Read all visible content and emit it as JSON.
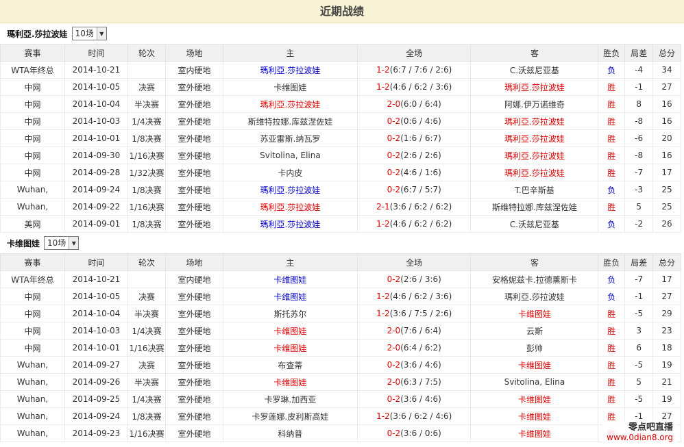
{
  "title": "近期战绩",
  "columns": [
    "赛事",
    "时间",
    "轮次",
    "场地",
    "主",
    "全场",
    "客",
    "胜负",
    "局差",
    "总分"
  ],
  "sections": [
    {
      "player": "瑪利亞.莎拉波娃",
      "count_option": "10场",
      "rows": [
        {
          "event": "WTA年终总",
          "date": "2014-10-21",
          "round": "",
          "surface": "室内硬地",
          "home": "瑪利亞.莎拉波娃",
          "home_style": "blue",
          "score_main": "1-2",
          "score_detail": "(6:7 / 7:6 / 2:6)",
          "away": "C.沃兹尼亚基",
          "away_style": "",
          "result": "负",
          "diff": "-4",
          "total": "34"
        },
        {
          "event": "中网",
          "date": "2014-10-05",
          "round": "决赛",
          "surface": "室外硬地",
          "home": "卡维图娃",
          "home_style": "",
          "score_main": "1-2",
          "score_detail": "(4:6 / 6:2 / 3:6)",
          "away": "瑪利亞.莎拉波娃",
          "away_style": "red",
          "result": "胜",
          "diff": "-1",
          "total": "27"
        },
        {
          "event": "中网",
          "date": "2014-10-04",
          "round": "半决赛",
          "surface": "室外硬地",
          "home": "瑪利亞.莎拉波娃",
          "home_style": "red",
          "score_main": "2-0",
          "score_detail": "(6:0 / 6:4)",
          "away": "阿娜.伊万诺维奇",
          "away_style": "",
          "result": "胜",
          "diff": "8",
          "total": "16"
        },
        {
          "event": "中网",
          "date": "2014-10-03",
          "round": "1/4决赛",
          "surface": "室外硬地",
          "home": "斯维特拉娜.库兹涅佐娃",
          "home_style": "",
          "score_main": "0-2",
          "score_detail": "(0:6 / 4:6)",
          "away": "瑪利亞.莎拉波娃",
          "away_style": "red",
          "result": "胜",
          "diff": "-8",
          "total": "16"
        },
        {
          "event": "中网",
          "date": "2014-10-01",
          "round": "1/8决赛",
          "surface": "室外硬地",
          "home": "苏亚雷斯.纳瓦罗",
          "home_style": "",
          "score_main": "0-2",
          "score_detail": "(1:6 / 6:7)",
          "away": "瑪利亞.莎拉波娃",
          "away_style": "red",
          "result": "胜",
          "diff": "-6",
          "total": "20"
        },
        {
          "event": "中网",
          "date": "2014-09-30",
          "round": "1/16决赛",
          "surface": "室外硬地",
          "home": "Svitolina, Elina",
          "home_style": "",
          "score_main": "0-2",
          "score_detail": "(2:6 / 2:6)",
          "away": "瑪利亞.莎拉波娃",
          "away_style": "red",
          "result": "胜",
          "diff": "-8",
          "total": "16"
        },
        {
          "event": "中网",
          "date": "2014-09-28",
          "round": "1/32决赛",
          "surface": "室外硬地",
          "home": "卡内皮",
          "home_style": "",
          "score_main": "0-2",
          "score_detail": "(4:6 / 1:6)",
          "away": "瑪利亞.莎拉波娃",
          "away_style": "red",
          "result": "胜",
          "diff": "-7",
          "total": "17"
        },
        {
          "event": "Wuhan,",
          "date": "2014-09-24",
          "round": "1/8决赛",
          "surface": "室外硬地",
          "home": "瑪利亞.莎拉波娃",
          "home_style": "blue",
          "score_main": "0-2",
          "score_detail": "(6:7 / 5:7)",
          "away": "T.巴辛斯基",
          "away_style": "",
          "result": "负",
          "diff": "-3",
          "total": "25"
        },
        {
          "event": "Wuhan,",
          "date": "2014-09-22",
          "round": "1/16决赛",
          "surface": "室外硬地",
          "home": "瑪利亞.莎拉波娃",
          "home_style": "red",
          "score_main": "2-1",
          "score_detail": "(3:6 / 6:2 / 6:2)",
          "away": "斯维特拉娜.库兹涅佐娃",
          "away_style": "",
          "result": "胜",
          "diff": "5",
          "total": "25"
        },
        {
          "event": "美网",
          "date": "2014-09-01",
          "round": "1/8决赛",
          "surface": "室外硬地",
          "home": "瑪利亞.莎拉波娃",
          "home_style": "blue",
          "score_main": "1-2",
          "score_detail": "(4:6 / 6:2 / 6:2)",
          "away": "C.沃兹尼亚基",
          "away_style": "",
          "result": "负",
          "diff": "-2",
          "total": "26"
        }
      ]
    },
    {
      "player": "卡维图娃",
      "count_option": "10场",
      "rows": [
        {
          "event": "WTA年终总",
          "date": "2014-10-21",
          "round": "",
          "surface": "室内硬地",
          "home": "卡维图娃",
          "home_style": "blue",
          "score_main": "0-2",
          "score_detail": "(2:6 / 3:6)",
          "away": "安格妮兹卡.拉德薰斯卡",
          "away_style": "",
          "result": "负",
          "diff": "-7",
          "total": "17"
        },
        {
          "event": "中网",
          "date": "2014-10-05",
          "round": "决赛",
          "surface": "室外硬地",
          "home": "卡维图娃",
          "home_style": "blue",
          "score_main": "1-2",
          "score_detail": "(4:6 / 6:2 / 3:6)",
          "away": "瑪利亞.莎拉波娃",
          "away_style": "",
          "result": "负",
          "diff": "-1",
          "total": "27"
        },
        {
          "event": "中网",
          "date": "2014-10-04",
          "round": "半决赛",
          "surface": "室外硬地",
          "home": "斯托苏尔",
          "home_style": "",
          "score_main": "1-2",
          "score_detail": "(3:6 / 7:5 / 2:6)",
          "away": "卡维图娃",
          "away_style": "red",
          "result": "胜",
          "diff": "-5",
          "total": "29"
        },
        {
          "event": "中网",
          "date": "2014-10-03",
          "round": "1/4决赛",
          "surface": "室外硬地",
          "home": "卡维图娃",
          "home_style": "red",
          "score_main": "2-0",
          "score_detail": "(7:6 / 6:4)",
          "away": "云斯",
          "away_style": "",
          "result": "胜",
          "diff": "3",
          "total": "23"
        },
        {
          "event": "中网",
          "date": "2014-10-01",
          "round": "1/16决赛",
          "surface": "室外硬地",
          "home": "卡维图娃",
          "home_style": "red",
          "score_main": "2-0",
          "score_detail": "(6:4 / 6:2)",
          "away": "彭帅",
          "away_style": "",
          "result": "胜",
          "diff": "6",
          "total": "18"
        },
        {
          "event": "Wuhan,",
          "date": "2014-09-27",
          "round": "决赛",
          "surface": "室外硬地",
          "home": "布查蒂",
          "home_style": "",
          "score_main": "0-2",
          "score_detail": "(3:6 / 4:6)",
          "away": "卡维图娃",
          "away_style": "red",
          "result": "胜",
          "diff": "-5",
          "total": "19"
        },
        {
          "event": "Wuhan,",
          "date": "2014-09-26",
          "round": "半决赛",
          "surface": "室外硬地",
          "home": "卡维图娃",
          "home_style": "red",
          "score_main": "2-0",
          "score_detail": "(6:3 / 7:5)",
          "away": "Svitolina, Elina",
          "away_style": "",
          "result": "胜",
          "diff": "5",
          "total": "21"
        },
        {
          "event": "Wuhan,",
          "date": "2014-09-25",
          "round": "1/4决赛",
          "surface": "室外硬地",
          "home": "卡罗琳.加西亚",
          "home_style": "",
          "score_main": "0-2",
          "score_detail": "(3:6 / 4:6)",
          "away": "卡维图娃",
          "away_style": "red",
          "result": "胜",
          "diff": "-5",
          "total": "19"
        },
        {
          "event": "Wuhan,",
          "date": "2014-09-24",
          "round": "1/8决赛",
          "surface": "室外硬地",
          "home": "卡罗莲娜.皮利斯高娃",
          "home_style": "",
          "score_main": "1-2",
          "score_detail": "(3:6 / 6:2 / 4:6)",
          "away": "卡维图娃",
          "away_style": "red",
          "result": "胜",
          "diff": "-1",
          "total": "27"
        },
        {
          "event": "Wuhan,",
          "date": "2014-09-23",
          "round": "1/16决赛",
          "surface": "室外硬地",
          "home": "科纳普",
          "home_style": "",
          "score_main": "0-2",
          "score_detail": "(3:6 / 0:6)",
          "away": "卡维图娃",
          "away_style": "red",
          "result": "胜",
          "diff": "",
          "total": ""
        }
      ]
    }
  ],
  "watermark": {
    "name": "零点吧直播",
    "url": "www.0dian8.org"
  }
}
